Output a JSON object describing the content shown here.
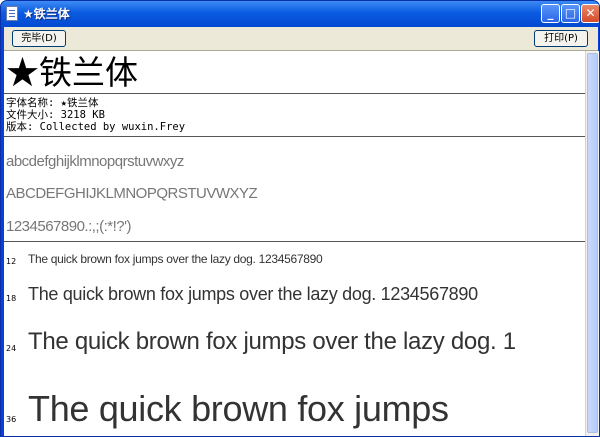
{
  "window": {
    "title": "★铁兰体",
    "buttons": {
      "minimize": "_",
      "maximize": "□",
      "close": "✕"
    }
  },
  "toolbar": {
    "done_label": "完毕(D)",
    "print_label": "打印(P)"
  },
  "font": {
    "display_name": "★铁兰体",
    "name_line": "字体名称: ★铁兰体",
    "size_line": "文件大小: 3218 KB",
    "version_line": "版本: Collected by wuxin.Frey"
  },
  "samples": {
    "lowercase": "abcdefghijklmnopqrstuvwxyz",
    "uppercase": "ABCDEFGHIJKLMNOPQRSTUVWXYZ",
    "digits": "1234567890.:,;(:*!?')"
  },
  "pangram_rows": [
    {
      "size": "12",
      "text": "The quick brown fox jumps over the lazy dog. 1234567890"
    },
    {
      "size": "18",
      "text": "The quick brown fox jumps over the lazy dog. 1234567890"
    },
    {
      "size": "24",
      "text": "The quick brown fox jumps over the lazy dog. 1"
    },
    {
      "size": "36",
      "text": "The quick brown fox jumps"
    }
  ]
}
